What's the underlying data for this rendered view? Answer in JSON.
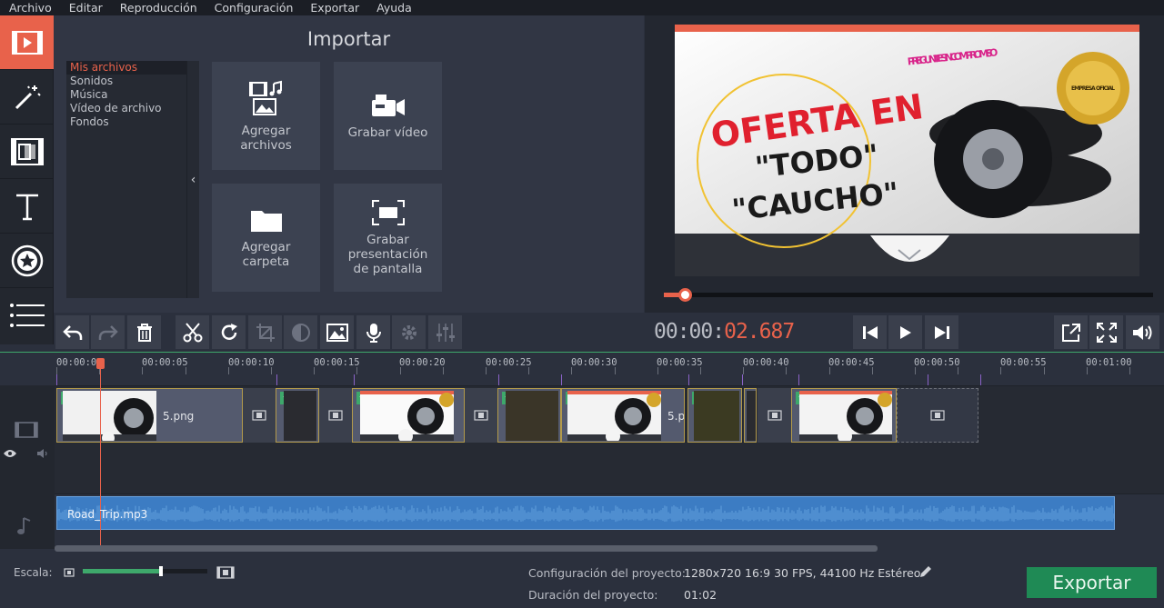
{
  "menu": [
    "Archivo",
    "Editar",
    "Reproducción",
    "Configuración",
    "Exportar",
    "Ayuda"
  ],
  "import": {
    "title": "Importar",
    "categories": [
      "Mis archivos",
      "Sonidos",
      "Música",
      "Vídeo de archivo",
      "Fondos"
    ],
    "tiles": {
      "add_files": "Agregar\narchivos",
      "record_video": "Grabar vídeo",
      "add_folder": "Agregar\ncarpeta",
      "screen_record": "Grabar\npresentación\nde pantalla"
    }
  },
  "preview": {
    "title_line1": "OFERTA EN",
    "title_line2": "\"TODO\"",
    "title_line3": "\"CAUCHO\"",
    "slogan": "PREGUNTE SIN COMPROMISO",
    "badge": "EMPRESA OFICIAL",
    "progress_fraction": 0.043
  },
  "timecode": {
    "prefix": "00:00:",
    "value": "02.687"
  },
  "ruler": [
    "00:00:00",
    "00:00:05",
    "00:00:10",
    "00:00:15",
    "00:00:20",
    "00:00:25",
    "00:00:30",
    "00:00:35",
    "00:00:40",
    "00:00:45",
    "00:00:50",
    "00:00:55",
    "00:01:00"
  ],
  "clips": {
    "clip1_name": "5.png",
    "clip5_name": "5.p"
  },
  "audio": {
    "name": "Road_Trip.mp3"
  },
  "status": {
    "scale_label": "Escala:",
    "scale_fraction": 0.63,
    "config_label": "Configuración del proyecto:",
    "config_value": "1280x720 16:9 30 FPS, 44100 Hz Estéreo",
    "duration_label": "Duración del proyecto:",
    "duration_value": "01:02",
    "export_label": "Exportar"
  },
  "colors": {
    "accent": "#e8624b",
    "export": "#1f8a55",
    "audio": "#3c7cc3"
  }
}
